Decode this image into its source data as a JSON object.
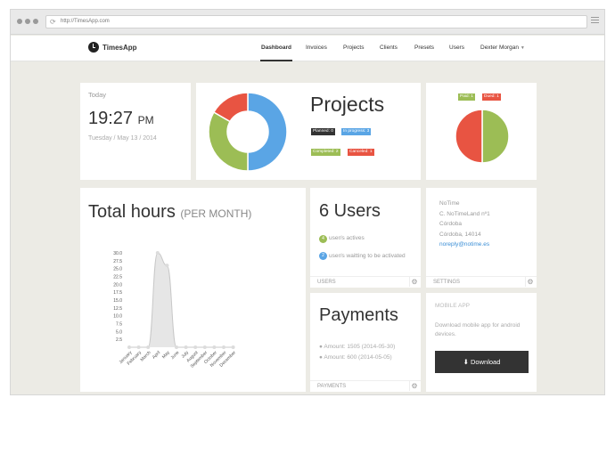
{
  "browser": {
    "url": "http://TimesApp.com"
  },
  "brand": {
    "name": "TimesApp"
  },
  "nav": {
    "items": [
      "Dashboard",
      "Invoices",
      "Projects",
      "Clients",
      "Presets",
      "Users"
    ],
    "user": "Dexter Morgan"
  },
  "today": {
    "label": "Today",
    "time": "19:27",
    "ampm": "PM",
    "date": "Tuesday / May 13 / 2014"
  },
  "projects": {
    "title": "Projects",
    "badges": {
      "planned": "Planned: 0",
      "in_progress": "In progress: 3",
      "completed": "Completed: 2",
      "canceled": "Canceled: 1"
    },
    "donut": [
      {
        "name": "In progress",
        "value": 3,
        "color": "#5aa5e5"
      },
      {
        "name": "Completed",
        "value": 2,
        "color": "#9cbd55"
      },
      {
        "name": "Canceled",
        "value": 1,
        "color": "#e85442"
      }
    ]
  },
  "payments_status": {
    "badges": {
      "paid": "Paid: 1",
      "dued": "Dued: 1"
    },
    "pie": [
      {
        "name": "Paid",
        "value": 1,
        "color": "#9cbd55"
      },
      {
        "name": "Dued",
        "value": 1,
        "color": "#e85442"
      }
    ]
  },
  "hours": {
    "title": "Total hours",
    "subtitle": "(PER MONTH)"
  },
  "chart_data": {
    "type": "area",
    "categories": [
      "January",
      "February",
      "March",
      "April",
      "May",
      "June",
      "July",
      "August",
      "September",
      "October",
      "November",
      "December"
    ],
    "values": [
      0,
      0,
      0,
      30,
      26,
      0,
      0,
      0,
      0,
      0,
      0,
      0
    ],
    "yticks": [
      "30.0",
      "27.5",
      "25.0",
      "22.5",
      "20.0",
      "17.5",
      "15.0",
      "12.5",
      "10.0",
      "7.5",
      "5.0",
      "2.5"
    ],
    "ylim": [
      0,
      30
    ],
    "colors": {
      "fill": "#e6e6e6",
      "line": "#c8c8c8",
      "point": "#dcdcdc"
    }
  },
  "users": {
    "title": "6 Users",
    "actives_count": "4",
    "actives_text": "user/s actives",
    "waiting_count": "2",
    "waiting_text": "user/s waitting to be activated",
    "footer": "USERS"
  },
  "company": {
    "name": "NoTime",
    "address": "C. NoTimeLand nº1",
    "city": "Córdoba",
    "zip": "Córdoba, 14014",
    "email": "noreply@notime.es",
    "footer": "SETTINGS"
  },
  "payments": {
    "title": "Payments",
    "items": [
      "Amount: 1505 (2014-05-30)",
      "Amount: 600 (2014-05-05)"
    ],
    "footer": "PAYMENTS"
  },
  "mobile": {
    "label": "MOBILE APP",
    "text": "Download mobile app for android devices.",
    "button": "Download"
  }
}
